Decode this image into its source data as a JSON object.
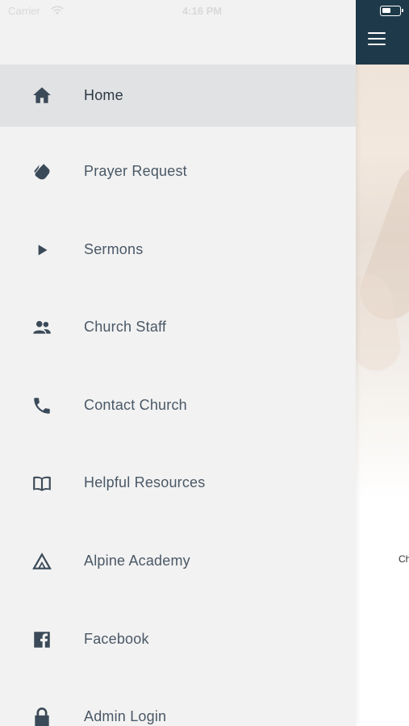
{
  "status_bar": {
    "carrier": "Carrier",
    "time": "4:16 PM"
  },
  "main_peek": {
    "peek_text": "Ch"
  },
  "drawer": {
    "items": [
      {
        "label": "Home",
        "icon": "home-icon",
        "active": true
      },
      {
        "label": "Prayer Request",
        "icon": "praying-hands-icon",
        "active": false
      },
      {
        "label": "Sermons",
        "icon": "play-icon",
        "active": false
      },
      {
        "label": "Church Staff",
        "icon": "people-icon",
        "active": false
      },
      {
        "label": "Contact Church",
        "icon": "phone-icon",
        "active": false
      },
      {
        "label": "Helpful Resources",
        "icon": "book-icon",
        "active": false
      },
      {
        "label": "Alpine Academy",
        "icon": "mountain-logo-icon",
        "active": false
      },
      {
        "label": "Facebook",
        "icon": "facebook-icon",
        "active": false
      },
      {
        "label": "Admin Login",
        "icon": "lock-icon",
        "active": false
      }
    ]
  },
  "colors": {
    "drawer_bg": "#f2f2f2",
    "active_bg": "#e1e2e3",
    "header_bg": "#1e3a4a",
    "icon": "#3b4a58",
    "label": "#4a5866"
  }
}
